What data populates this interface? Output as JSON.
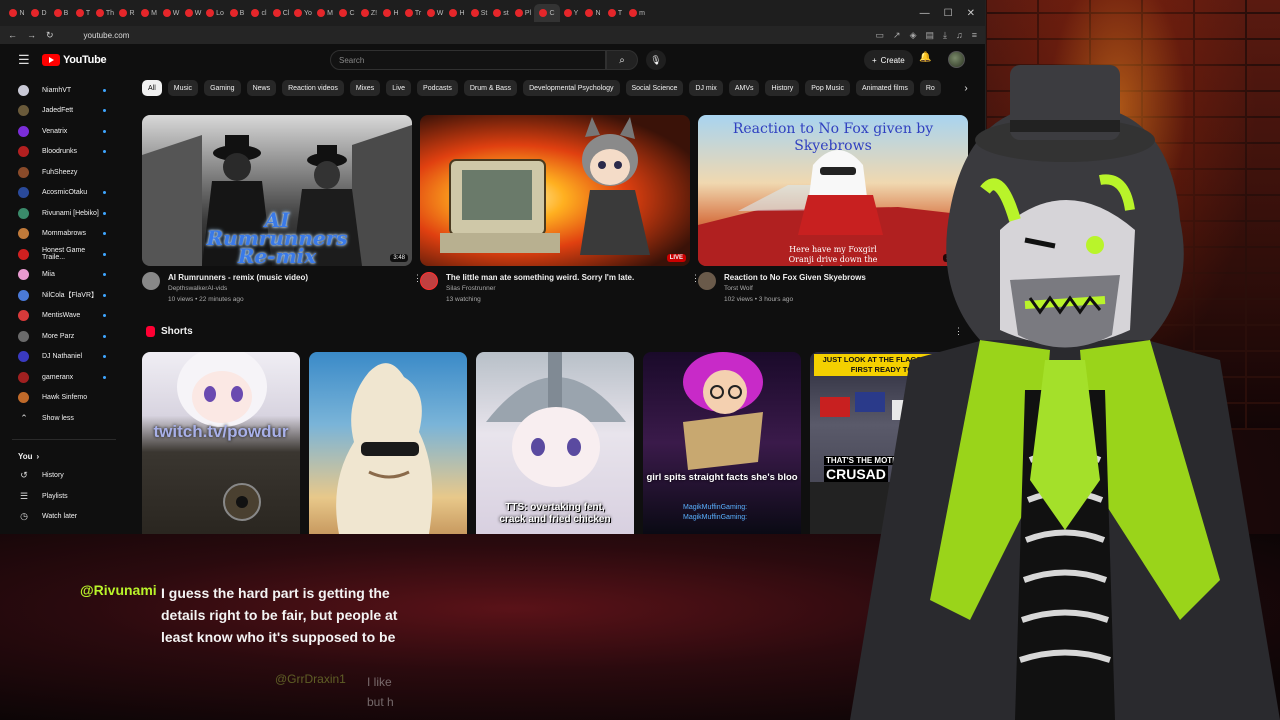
{
  "browser": {
    "tabs": [
      "N",
      "D",
      "B",
      "T",
      "Th",
      "R",
      "M",
      "W",
      "W",
      "Lo",
      "B",
      "cl",
      "Cl",
      "Yo",
      "M",
      "C",
      "Z!",
      "H",
      "Tr",
      "W",
      "H",
      "St",
      "st",
      "Pl",
      "C",
      "Y",
      "N",
      "T",
      "m"
    ],
    "url": "youtube.com",
    "window_controls": [
      "—",
      "☐",
      "✕"
    ]
  },
  "header": {
    "logo_text": "YouTube",
    "search_placeholder": "Search",
    "create_label": "Create"
  },
  "sidebar": {
    "subscriptions": [
      {
        "name": "NiamhVT",
        "live": true,
        "color": "#c9c9d6"
      },
      {
        "name": "JadedFett",
        "live": true,
        "color": "#6a5a3a"
      },
      {
        "name": "Venatrix",
        "live": true,
        "color": "#7a2dd8"
      },
      {
        "name": "Bloodrunks",
        "live": true,
        "color": "#b32020"
      },
      {
        "name": "FuhSheezy",
        "live": false,
        "color": "#8a4b2a"
      },
      {
        "name": "AcosmicOtaku",
        "live": true,
        "color": "#2a4a9a"
      },
      {
        "name": "Rivunami [Hebiko]",
        "live": true,
        "color": "#3a8a6a"
      },
      {
        "name": "Mommabrows",
        "live": true,
        "color": "#c07a3a"
      },
      {
        "name": "Honest Game Traile...",
        "live": true,
        "color": "#d02020"
      },
      {
        "name": "Miia",
        "live": true,
        "color": "#e89ad0"
      },
      {
        "name": "NilCola【FlaVR】",
        "live": true,
        "color": "#4a7ad8"
      },
      {
        "name": "MentisWave",
        "live": true,
        "color": "#d83a3a"
      },
      {
        "name": "More Parz",
        "live": true,
        "color": "#6a6a6a"
      },
      {
        "name": "DJ Nathaniel",
        "live": true,
        "color": "#3a3ac0"
      },
      {
        "name": "gameranx",
        "live": true,
        "color": "#a02020"
      },
      {
        "name": "Hawk Sinfemo",
        "live": false,
        "color": "#c06a2a"
      }
    ],
    "show_less": "Show less",
    "you_label": "You",
    "you_items": [
      "History",
      "Playlists",
      "Watch later"
    ]
  },
  "chips": [
    "All",
    "Music",
    "Gaming",
    "News",
    "Reaction videos",
    "Mixes",
    "Live",
    "Podcasts",
    "Drum & Bass",
    "Developmental Psychology",
    "Social Science",
    "DJ mix",
    "AMVs",
    "History",
    "Pop Music",
    "Animated films",
    "Ro"
  ],
  "videos": [
    {
      "title": "AI Rumrunners - remix (music video)",
      "channel": "DepthswalkerAI-vids",
      "stats": "10 views • 22 minutes ago",
      "duration": "3:48",
      "thumb_text": "AI Rumrunners Re-mix",
      "channel_color": "#888888"
    },
    {
      "title": "The little man ate something weird. Sorry I'm late.",
      "channel": "Silas Frostrunner",
      "stats": "13 watching",
      "badge": "LIVE",
      "channel_color": "#c04040"
    },
    {
      "title": "Reaction to No Fox Given  Skyebrows",
      "channel": "Torst Wolf",
      "stats": "102 views • 3 hours ago",
      "duration": "19:42",
      "thumb_text": "Reaction to No Fox given by Skyebrows",
      "thumb_caption": "Here have my Foxgirl Oranji drive down the beach",
      "channel_color": "#6a5a4a"
    }
  ],
  "shorts": {
    "heading": "Shorts",
    "items": [
      {
        "caption": "twitch.tv/powdur"
      },
      {
        "caption": ""
      },
      {
        "caption": "TTS: overtaking fent, crack and fried chicken"
      },
      {
        "caption": "girl spits straight facts she's bloo",
        "chat_lines": [
          "MagikMuffinGaming:",
          "MagikMuffinGaming:"
        ]
      },
      {
        "caption": "JUST LOOK AT THE FLAGS. BRITAIN FIRST READY TO MO",
        "caption2": "THAT'S THE MOTH",
        "caption3": "CRUSAD"
      }
    ]
  },
  "chat": [
    {
      "user": "@Rivunami",
      "message": "I guess the hard part is getting the details right to be fair, but people at least know who it's supposed to be"
    },
    {
      "user": "@GrrDraxin1",
      "message": "I like but h"
    }
  ],
  "colors": {
    "accent_green": "#b9f42a",
    "yt_red": "#ff0000"
  }
}
